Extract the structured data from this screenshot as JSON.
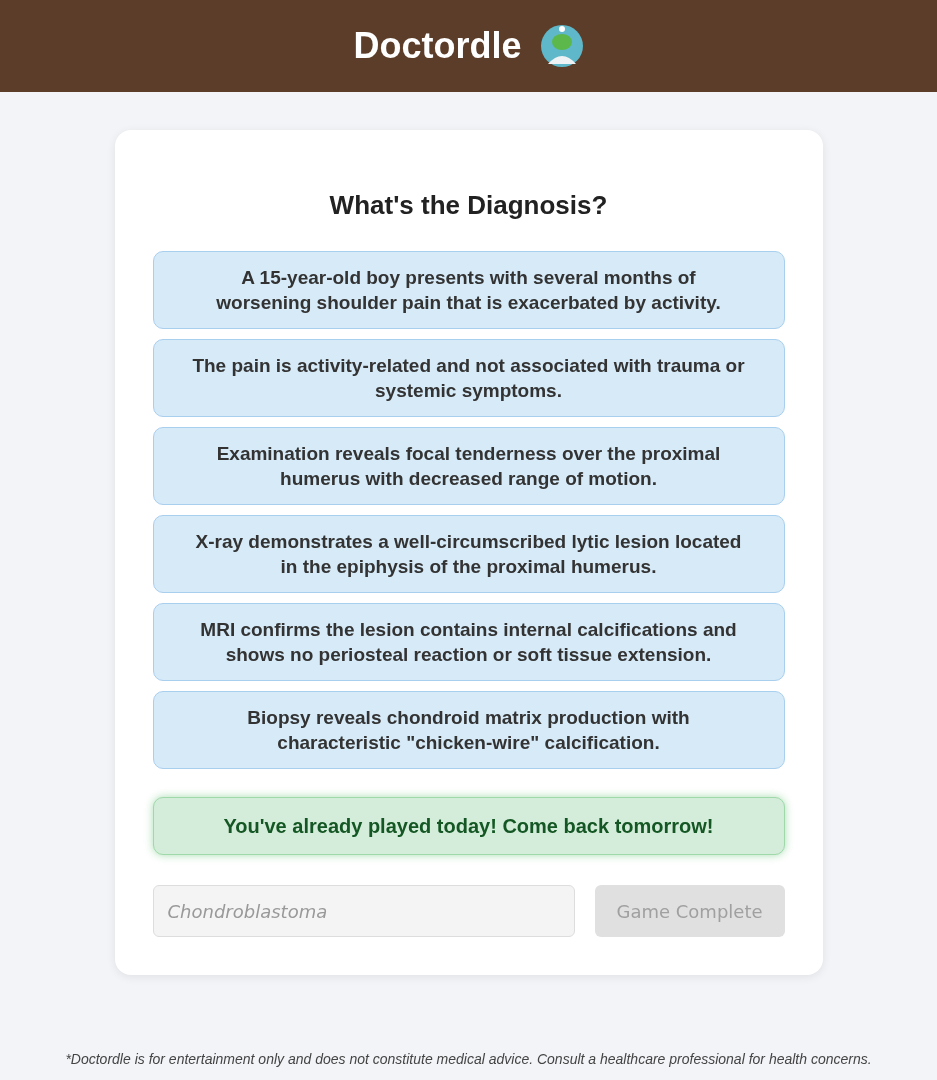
{
  "header": {
    "title": "Doctordle"
  },
  "card": {
    "heading": "What's the Diagnosis?",
    "clues": [
      "A 15-year-old boy presents with several months of worsening shoulder pain that is exacerbated by activity.",
      "The pain is activity-related and not associated with trauma or systemic symptoms.",
      "Examination reveals focal tenderness over the proximal humerus with decreased range of motion.",
      "X-ray demonstrates a well-circumscribed lytic lesion located in the epiphysis of the proximal humerus.",
      "MRI confirms the lesion contains internal calcifications and shows no periosteal reaction or soft tissue extension.",
      "Biopsy reveals chondroid matrix production with characteristic \"chicken-wire\" calcification."
    ],
    "message": "You've already played today! Come back tomorrow!",
    "guess": {
      "placeholder": "Chondroblastoma",
      "disabled": true
    },
    "submit": {
      "label": "Game Complete",
      "disabled": true
    }
  },
  "footer": {
    "disclaimer": "*Doctordle is for entertainment only and does not constitute medical advice. Consult a healthcare professional for health concerns."
  }
}
